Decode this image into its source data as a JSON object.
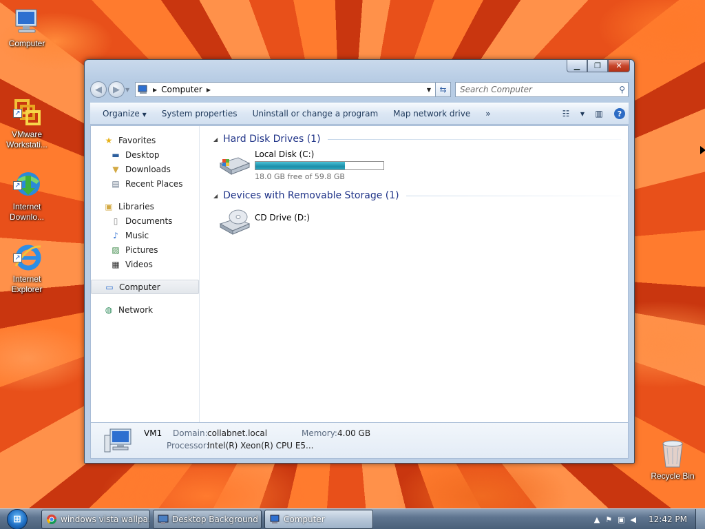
{
  "desktop": {
    "icons": [
      {
        "label": "Computer",
        "icon": "computer-icon"
      },
      {
        "label": "VMware\nWorkstati...",
        "icon": "vmware-icon"
      },
      {
        "label": "Internet\nDownlo...",
        "icon": "internet-download-manager-icon"
      },
      {
        "label": "Internet\nExplorer",
        "icon": "internet-explorer-icon"
      }
    ],
    "recycle_bin": {
      "label": "Recycle Bin",
      "icon": "recycle-bin-icon"
    }
  },
  "window": {
    "address": {
      "crumb": "Computer"
    },
    "search": {
      "placeholder": "Search Computer"
    },
    "toolbar": {
      "organize": "Organize",
      "system_properties": "System properties",
      "uninstall": "Uninstall or change a program",
      "map_network_drive": "Map network drive",
      "more": "»"
    },
    "nav_pane": {
      "favorites": {
        "label": "Favorites",
        "items": [
          "Desktop",
          "Downloads",
          "Recent Places"
        ]
      },
      "libraries": {
        "label": "Libraries",
        "items": [
          "Documents",
          "Music",
          "Pictures",
          "Videos"
        ]
      },
      "computer": "Computer",
      "network": "Network"
    },
    "groups": [
      {
        "title": "Hard Disk Drives (1)",
        "drives": [
          {
            "name": "Local Disk (C:)",
            "free_text": "18.0 GB free of 59.8 GB",
            "used_fraction": 0.699
          }
        ]
      },
      {
        "title": "Devices with Removable Storage (1)",
        "drives": [
          {
            "name": "CD Drive (D:)"
          }
        ]
      }
    ],
    "details": {
      "name": "VM1",
      "domain_label": "Domain:",
      "domain": "collabnet.local",
      "memory_label": "Memory:",
      "memory": "4.00 GB",
      "processor_label": "Processor:",
      "processor": "Intel(R) Xeon(R) CPU E5..."
    }
  },
  "taskbar": {
    "buttons": [
      {
        "label": "windows vista wallpa...",
        "icon": "chrome-icon"
      },
      {
        "label": "Desktop Background",
        "icon": "desktop-background-icon"
      },
      {
        "label": "Computer",
        "icon": "computer-icon"
      }
    ],
    "clock": "12:42 PM"
  },
  "colors": {
    "accent": "#1e3287",
    "progress": "#1d8ea8",
    "close": "#c7452a"
  }
}
